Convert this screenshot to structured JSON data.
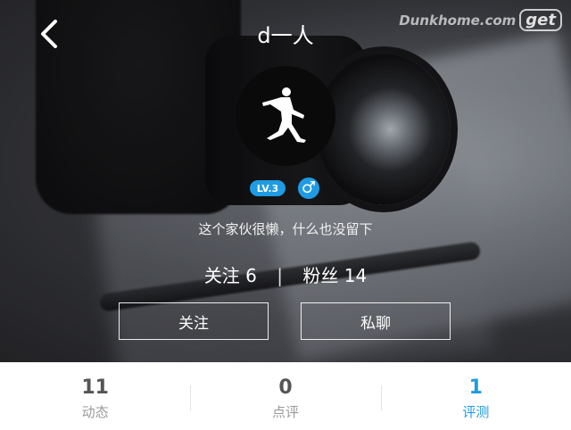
{
  "header": {
    "title": "d一人",
    "back_icon": "chevron-left-icon",
    "watermark_text": "Dunkhome.com",
    "watermark_badge": "get"
  },
  "profile": {
    "avatar_icon": "jumpman-logo",
    "level": "LV.3",
    "gender_icon": "male-icon",
    "gender_symbol": "♂",
    "bio": "这个家伙很懒，什么也没留下",
    "following_label": "关注 6",
    "separator": "|",
    "followers_label": "粉丝 14"
  },
  "actions": {
    "follow_label": "关注",
    "message_label": "私聊"
  },
  "tabs": [
    {
      "count": "11",
      "label": "动态"
    },
    {
      "count": "0",
      "label": "点评"
    },
    {
      "count": "1",
      "label": "评测"
    }
  ],
  "colors": {
    "accent": "#1f9be3",
    "tab_inactive": "#555555",
    "tab_label_inactive": "#9a9a9a"
  }
}
